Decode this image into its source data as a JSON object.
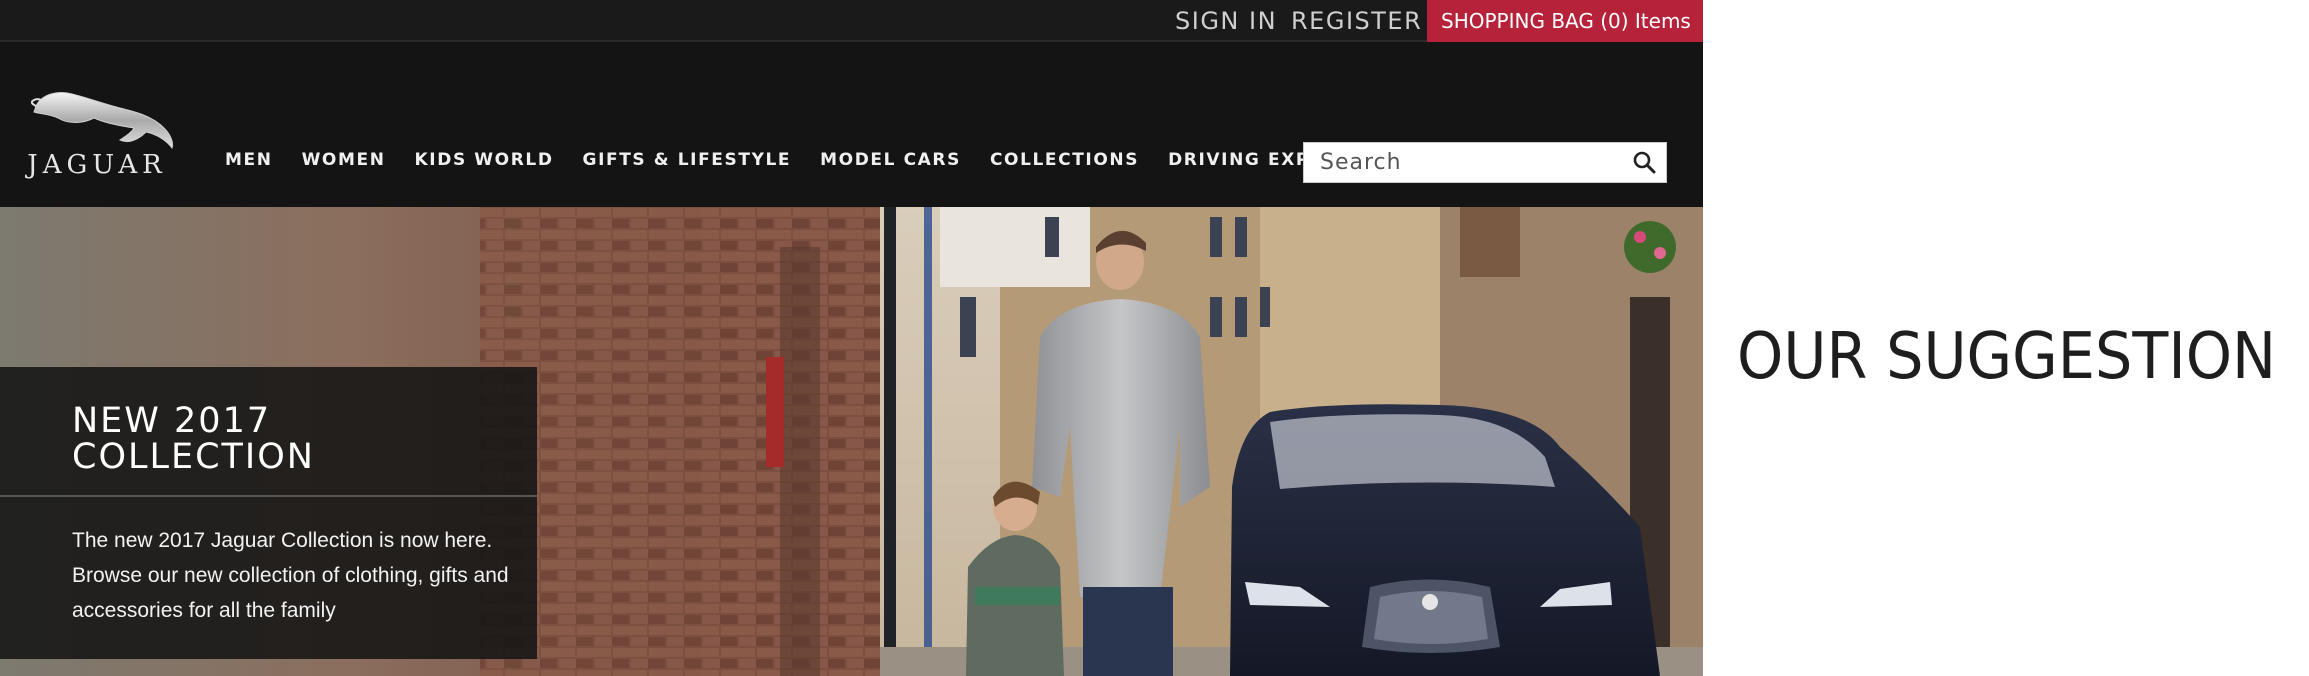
{
  "topbar": {
    "sign_in": "SIGN IN",
    "register": "REGISTER",
    "shopping_bag": "SHOPPING BAG (0) Items",
    "bag_color": "#b6223a"
  },
  "header": {
    "logo_text": "JAGUAR",
    "logo_icon": "jaguar-leaper-icon",
    "nav": [
      {
        "label": "MEN"
      },
      {
        "label": "WOMEN"
      },
      {
        "label": "KIDS WORLD"
      },
      {
        "label": "GIFTS & LIFESTYLE"
      },
      {
        "label": "MODEL CARS"
      },
      {
        "label": "COLLECTIONS"
      },
      {
        "label": "DRIVING EXPERIENCES"
      }
    ],
    "search": {
      "placeholder": "Search",
      "icon": "search-icon"
    }
  },
  "hero": {
    "promo_title": "NEW 2017\nCOLLECTION",
    "promo_body": "The new 2017 Jaguar Collection is now here. Browse our new collection of clothing, gifts and accessories for all the family"
  },
  "caption": {
    "text": "OUR SUGGESTION"
  }
}
